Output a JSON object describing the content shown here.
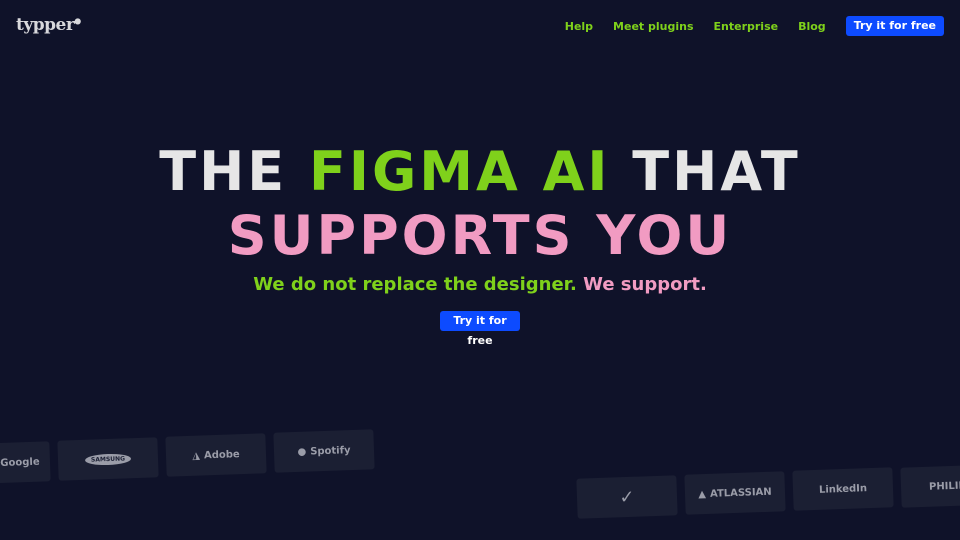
{
  "header": {
    "logo": "typper",
    "nav": [
      "Help",
      "Meet plugins",
      "Enterprise",
      "Blog"
    ],
    "cta": "Try it for free"
  },
  "hero": {
    "line1_a": "THE ",
    "line1_b": "FIGMA AI",
    "line1_c": " THAT",
    "line2": "SUPPORTS YOU",
    "sub_a": "We do not replace the designer.",
    "sub_b": " We support.",
    "cta": "Try it for free"
  },
  "logos_row1": [
    "Google",
    "SAMSUNG",
    "Adobe",
    "Spotify"
  ],
  "logos_row2": [
    "Nike",
    "ATLASSIAN",
    "LinkedIn",
    "PHILIPS"
  ],
  "colors": {
    "background": "#0f1229",
    "accent_green": "#7fd11b",
    "accent_pink": "#f19bc2",
    "button": "#0d4bff"
  }
}
